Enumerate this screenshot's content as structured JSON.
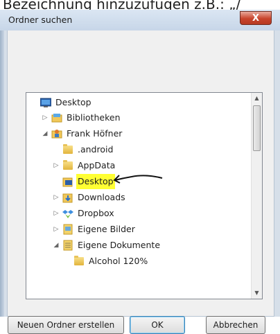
{
  "caption": "Bezeichnung hinzuzufügen z.B.: „/",
  "dialog": {
    "title": "Ordner suchen",
    "close_symbol": "X"
  },
  "tree": {
    "items": [
      {
        "label": "Desktop",
        "icon": "desktop-icon",
        "expander": "",
        "level": 0
      },
      {
        "label": "Bibliotheken",
        "icon": "libraries-icon",
        "expander": "▷",
        "level": 1
      },
      {
        "label": "Frank Höfner",
        "icon": "user-folder-icon",
        "expander": "◢",
        "level": 1
      },
      {
        "label": ".android",
        "icon": "folder-icon",
        "expander": "",
        "level": 2
      },
      {
        "label": "AppData",
        "icon": "folder-icon",
        "expander": "▷",
        "level": 2
      },
      {
        "label": "Desktop",
        "icon": "desktop-folder-icon",
        "expander": "",
        "level": 2,
        "highlighted": true
      },
      {
        "label": "Downloads",
        "icon": "downloads-folder-icon",
        "expander": "▷",
        "level": 2
      },
      {
        "label": "Dropbox",
        "icon": "dropbox-icon",
        "expander": "▷",
        "level": 2
      },
      {
        "label": "Eigene Bilder",
        "icon": "pictures-folder-icon",
        "expander": "▷",
        "level": 2
      },
      {
        "label": "Eigene Dokumente",
        "icon": "documents-folder-icon",
        "expander": "◢",
        "level": 2
      },
      {
        "label": "Alcohol 120%",
        "icon": "folder-icon",
        "expander": "",
        "level": 3
      }
    ]
  },
  "buttons": {
    "new_folder": "Neuen Ordner erstellen",
    "ok": "OK",
    "cancel": "Abbrechen"
  },
  "scrollbar": {
    "up_icon": "▲",
    "down_icon": "▼"
  }
}
